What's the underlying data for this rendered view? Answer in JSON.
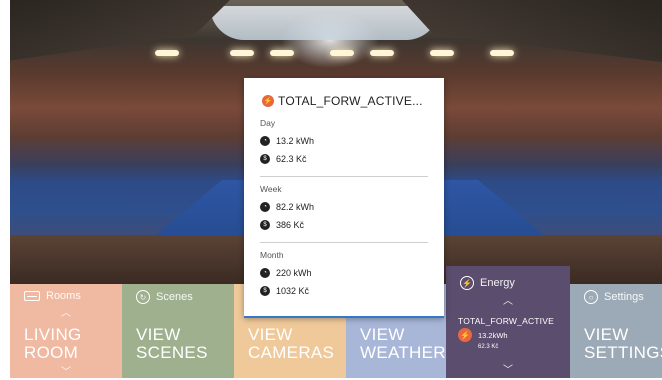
{
  "popup": {
    "title": "TOTAL_FORW_ACTIVE...",
    "day": {
      "label": "Day",
      "kwh": "13.2 kWh",
      "kc": "62.3 Kč"
    },
    "week": {
      "label": "Week",
      "kwh": "82.2 kWh",
      "kc": "386 Kč"
    },
    "month": {
      "label": "Month",
      "kwh": "220 kWh",
      "kc": "1032 Kč"
    }
  },
  "tiles": {
    "rooms": {
      "header": "Rooms",
      "main": "LIVING\nROOM",
      "color": "#f0b9a2"
    },
    "scenes": {
      "header": "Scenes",
      "main": "VIEW\nSCENES",
      "color": "#9eb08e"
    },
    "cameras": {
      "main": "VIEW\nCAMERAS",
      "color": "#f0c99a"
    },
    "weather": {
      "main": "VIEW\nWEATHER",
      "color": "#a8b6d8"
    },
    "energy": {
      "header": "Energy",
      "name": "TOTAL_FORW_ACTIVE",
      "kwh": "13.2kWh",
      "kc": "62.3 Kč",
      "color": "#5a4d6d"
    },
    "settings": {
      "header": "Settings",
      "main": "VIEW\nSETTINGS",
      "color": "#9ca9b6"
    }
  },
  "icons": {
    "popup": "lightning-bolt-icon",
    "energy": "energy-icon",
    "counter": "counter-icon",
    "coin": "coin-icon"
  },
  "colors": {
    "accent_blue": "#3478c6",
    "bolt_orange": "#e8673e"
  }
}
